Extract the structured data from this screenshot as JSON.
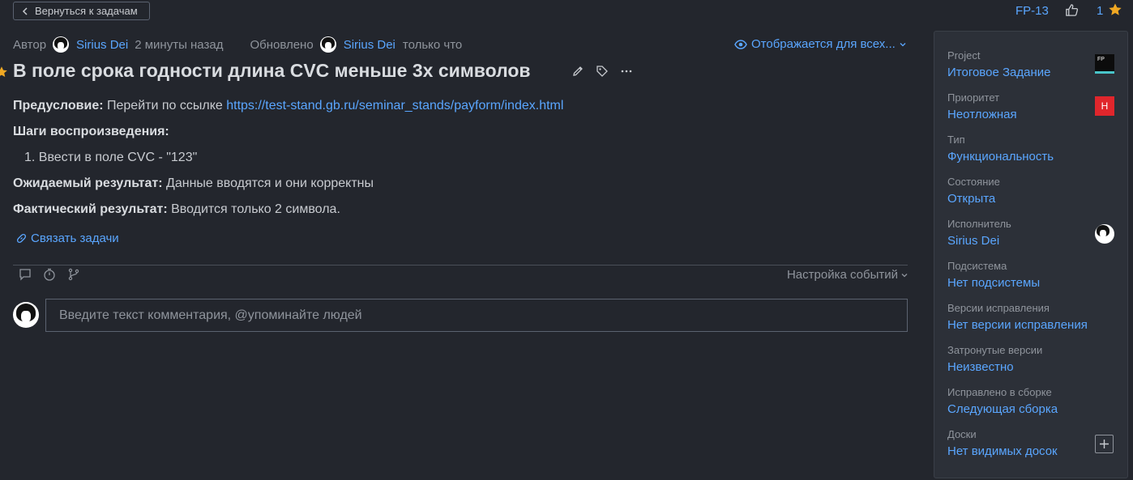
{
  "topbar": {
    "back_label": "Вернуться к задачам",
    "issue_id": "FP-13",
    "star_count": "1"
  },
  "meta": {
    "author_label": "Автор",
    "author_name": "Sirius Dei",
    "author_time": "2 минуты назад",
    "updated_label": "Обновлено",
    "updater_name": "Sirius Dei",
    "updated_time": "только что",
    "visibility": "Отображается для всех..."
  },
  "issue": {
    "title": "В поле срока годности длина CVC меньше 3х символов",
    "precondition_label": "Предусловие:",
    "precondition_text": "Перейти по ссылке",
    "precondition_url": "https://test-stand.gb.ru/seminar_stands/payform/index.html",
    "steps_label": "Шаги воспроизведения:",
    "step_1": "1. Ввести в поле CVC - \"123\"",
    "expected_label": "Ожидаемый результат:",
    "expected_text": "Данные вводятся и они корректны",
    "actual_label": "Фактический результат:",
    "actual_text": "Вводится только 2 символа."
  },
  "links": {
    "link_issues": "Связать задачи"
  },
  "activity": {
    "events_settings": "Настройка событий",
    "comment_placeholder": "Введите текст комментария, @упоминайте людей"
  },
  "sidebar": {
    "project_label": "Project",
    "project_value": "Итоговое Задание",
    "project_badge": "FP",
    "priority_label": "Приоритет",
    "priority_value": "Неотложная",
    "priority_badge": "Н",
    "type_label": "Тип",
    "type_value": "Функциональность",
    "state_label": "Состояние",
    "state_value": "Открыта",
    "assignee_label": "Исполнитель",
    "assignee_value": "Sirius Dei",
    "subsystem_label": "Подсистема",
    "subsystem_value": "Нет подсистемы",
    "fix_versions_label": "Версии исправления",
    "fix_versions_value": "Нет версии исправления",
    "affected_label": "Затронутые версии",
    "affected_value": "Неизвестно",
    "fixed_build_label": "Исправлено в сборке",
    "fixed_build_value": "Следующая сборка",
    "boards_label": "Доски",
    "boards_value": "Нет видимых досок"
  },
  "colors": {
    "background": "#23262d",
    "sidebar": "#2c3038",
    "link": "#5aa6ff",
    "star": "#f0a823",
    "priority": "#e0262c"
  }
}
